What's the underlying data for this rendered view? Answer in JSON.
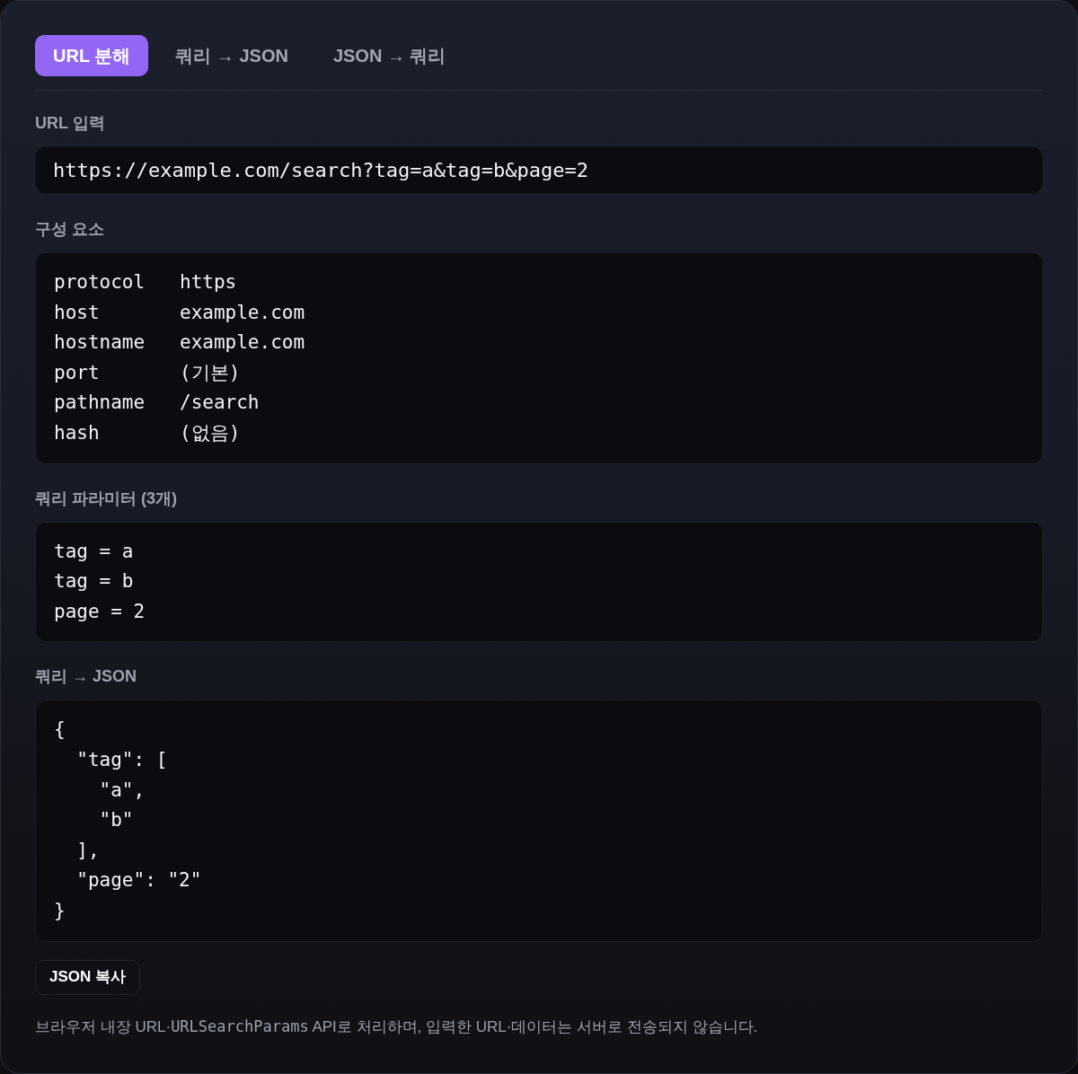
{
  "tabs": [
    {
      "label": "URL 분해",
      "selected": true
    },
    {
      "label": "쿼리 → JSON",
      "selected": false
    },
    {
      "label": "JSON → 쿼리",
      "selected": false
    }
  ],
  "url_section": {
    "label": "URL 입력",
    "value": "https://example.com/search?tag=a&tag=b&page=2"
  },
  "components_section": {
    "label": "구성 요소",
    "rows": [
      {
        "key": "protocol",
        "value": "https"
      },
      {
        "key": "host",
        "value": "example.com"
      },
      {
        "key": "hostname",
        "value": "example.com"
      },
      {
        "key": "port",
        "value": "(기본)"
      },
      {
        "key": "pathname",
        "value": "/search"
      },
      {
        "key": "hash",
        "value": "(없음)"
      }
    ]
  },
  "params_section": {
    "label": "쿼리 파라미터 (3개)",
    "lines": [
      "tag = a",
      "tag = b",
      "page = 2"
    ]
  },
  "json_section": {
    "label": "쿼리 → JSON",
    "lines": [
      "{",
      "  \"tag\": [",
      "    \"a\",",
      "    \"b\"",
      "  ],",
      "  \"page\": \"2\"",
      "}"
    ]
  },
  "copy_button": {
    "label": "JSON 복사"
  },
  "footer": {
    "text_before": "브라우저 내장 URL·",
    "code": "URLSearchParams",
    "text_after": " API로 처리하며, 입력한 URL·데이터는 서버로 전송되지 않습니다."
  }
}
